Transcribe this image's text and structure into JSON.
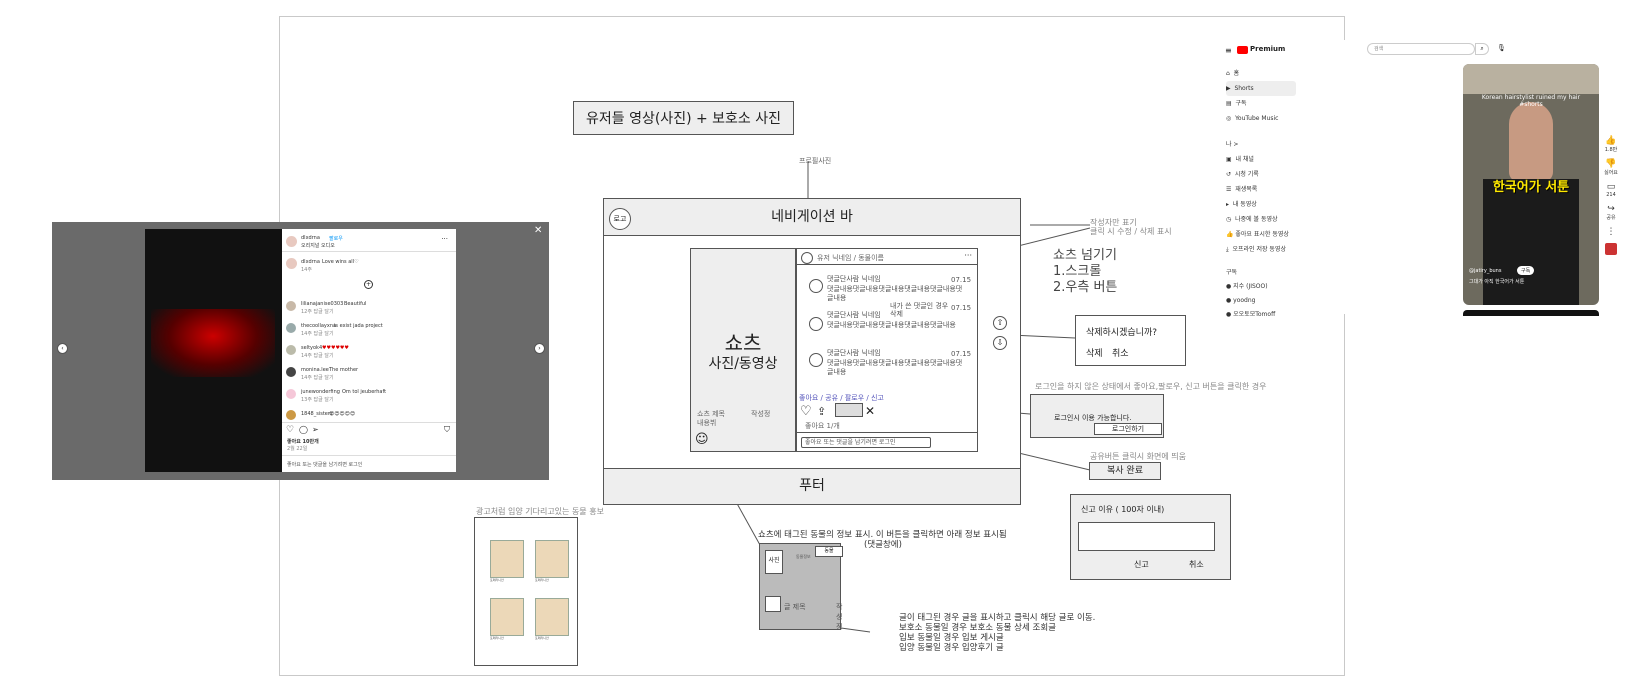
{
  "board": {
    "title": "유저들 영상(사진) + 보호소 사진",
    "profile_photo_note": "프로필사진",
    "writer_note_1": "작성자만 표기",
    "writer_note_2": "클릭 시 수정 / 삭제 표시",
    "shorts_skip_title": "쇼츠 넘기기",
    "shorts_skip_1": "1.스크롤",
    "shorts_skip_2": "2.우측 버튼",
    "login_note": "로그인을 하지 않은 상태에서 좋아요,팔로우, 신고 버튼을 클릭한 경우",
    "share_note": "공유버튼 클릭시 화면에 띄움",
    "ad_note": "광고처럼 입양 기다리고있는 동물 홍보",
    "tag_note_1": "쇼츠에 태그된 동물의 정보 표시. 이 버튼을 클릭하면 아래 정보 표시됨",
    "tag_note_2": "(댓글창에)",
    "bottom_note_1": "글이 태그된 경우 글을 표시하고 클릭시 해당 글로 이동.",
    "bottom_note_2": "보호소 동물일 경우 보호소 동물 상세 조회글",
    "bottom_note_3": "입보 동물일 경우 입보 게시글",
    "bottom_note_4": "입양 동물일 경우 입양후기 글"
  },
  "wireframe": {
    "nav": "네비게이션 바",
    "logo": "로고",
    "footer": "푸터",
    "shorts_title": "쇼츠",
    "shorts_sub": "사진/동영상",
    "shorts_meta_title": "쇼츠 제목",
    "shorts_meta_body": "내용뷔",
    "shorts_meta_writer": "작성정",
    "header_user": "유저 닉네임 / 동물이름",
    "more": "···",
    "comments": [
      {
        "nick": "댓글단사람 닉네임",
        "date": "07.15",
        "text": "댓글내용댓글내용댓글내용댓글내용댓글내용댓글내용"
      },
      {
        "nick": "댓글단사람 닉네임",
        "date": "07.15",
        "text": "댓글내용댓글내용댓글내용댓글내용댓글내용"
      },
      {
        "nick": "댓글단사람 닉네임",
        "date": "07.15",
        "text": "댓글내용댓글내용댓글내용댓글내용댓글내용댓글내용"
      }
    ],
    "my_comment_note": "내가 쓴 댓글인 경우",
    "my_comment_delete": "삭제",
    "actions_label": "좋아요 / 공유 / 팔로우 / 신고",
    "like_count": "좋아요 1/개",
    "comment_placeholder": "좋아요 또는 댓글을 남기려면 로그인",
    "tag_btn": "태그"
  },
  "dialogs": {
    "delete_q": "삭제하시겠습니까?",
    "delete_btn": "삭제",
    "cancel_btn": "취소",
    "login_msg": "로그인시 이용 가능합니다.",
    "login_btn": "로그인하기",
    "copy_done": "복사 완료",
    "report_title": "신고 이유 ( 100자 이내)",
    "report_btn": "신고",
    "report_cancel": "취소"
  },
  "tag_card": {
    "photo": "사진",
    "info": "동물정보",
    "btn": "동물",
    "title": "글 제목",
    "writer": "작성정"
  },
  "ad": {
    "cards": [
      {
        "name": "포메라니안"
      },
      {
        "name": "포메라니안"
      },
      {
        "name": "포메라니안"
      },
      {
        "name": "포메라니안"
      }
    ]
  },
  "instagram": {
    "username": "dlxdrna",
    "follow": "팔로우",
    "subtitle": "오리지널 오디오",
    "caption_user": "dlxdrna",
    "caption": "Love wins all♡",
    "caption_time": "14주",
    "comments": [
      {
        "user": "lilianajanise0303",
        "text": "Beautiful",
        "meta": "12주 답글 달기"
      },
      {
        "user": "thecoollayxna",
        "text": "is exist jada project",
        "meta": "14주 답글 달기"
      },
      {
        "user": "seltyok4",
        "text": "♥♥♥♥♥♥",
        "meta": "14주 답글 달기"
      },
      {
        "user": "monina.lee",
        "text": "The mother",
        "meta": "14주 답글 달기"
      },
      {
        "user": "junewonderfing",
        "text": "Om tol jeuberhaft",
        "meta": "13주 답글 달기"
      },
      {
        "user": "1848_sisters",
        "text": "😍😍😍😍😍",
        "meta": ""
      }
    ],
    "likes": "좋아요 10만개",
    "date": "2월 22일",
    "footer": "좋아요 또는 댓글을 남기려면 로그인"
  },
  "youtube": {
    "brand": "Premium",
    "search_placeholder": "검색",
    "nav": [
      "홈",
      "Shorts",
      "구독",
      "YouTube Music"
    ],
    "me_header": "나 >",
    "me_items": [
      "내 채널",
      "시청 기록",
      "재생목록",
      "내 동영상",
      "나중에 볼 동영상",
      "좋아요 표시한 동영상",
      "오프라인 저장 동영상"
    ],
    "subs_header": "구독",
    "subs": [
      "지수 (JISOO)",
      "yoodng",
      "오오토모Tomoff"
    ],
    "video_caption": "Korean hairstylist ruined my hair",
    "video_sub": "#shorts",
    "video_overlay": "한국어가 서툰",
    "channel": "@jatiry_buns",
    "subscribe": "구독",
    "desc": "그대가 아직 한국어가 서툰",
    "likes": "1.8만",
    "dislike": "싫어요",
    "comments": "214",
    "share": "공유"
  },
  "colors": {
    "accent": "#ff0000",
    "insta_blue": "#0095f6",
    "wire_gray": "#eeeeee"
  }
}
